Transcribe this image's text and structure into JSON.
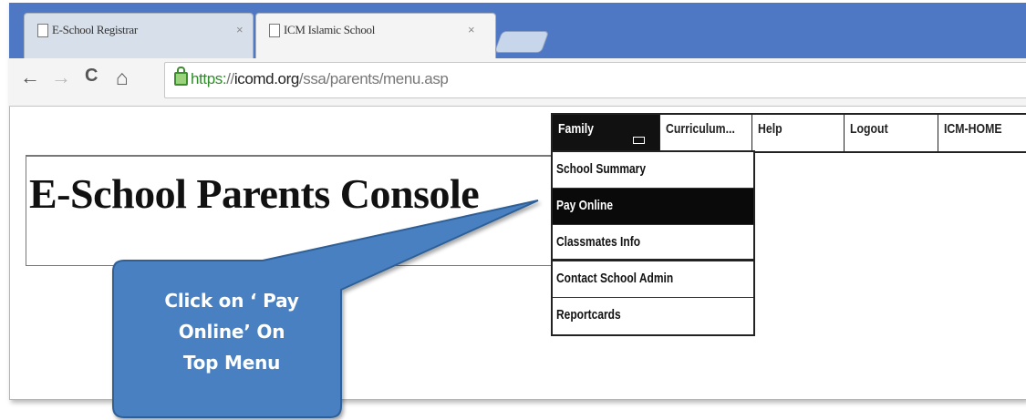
{
  "browser": {
    "tabs": [
      {
        "title": "E-School Registrar",
        "close": "×",
        "active": false
      },
      {
        "title": "ICM Islamic School",
        "close": "×",
        "active": true
      }
    ],
    "url": {
      "scheme": "https:",
      "sep": "//",
      "host": "icomd.org",
      "path": "/ssa/parents/menu.asp"
    }
  },
  "nav": {
    "back_icon": "←",
    "forward_icon": "→",
    "reload_icon": "C",
    "home_icon": "⌂"
  },
  "page": {
    "title": "E-School Parents Console",
    "menu": [
      {
        "label": "Family",
        "active": true
      },
      {
        "label": "Curriculum..."
      },
      {
        "label": "Help"
      },
      {
        "label": "Logout"
      },
      {
        "label": "ICM-HOME"
      }
    ],
    "dropdown": [
      {
        "label": "School Summary"
      },
      {
        "label": "Pay Online",
        "highlighted": true
      },
      {
        "label": "Classmates Info"
      },
      {
        "label": "Contact School Admin"
      },
      {
        "label": "Reportcards"
      }
    ]
  },
  "callout": {
    "lines": [
      "Click on ‘ Pay",
      "Online’ On",
      "Top Menu"
    ],
    "fill": "#4a80c1",
    "stroke": "#2f5f96"
  },
  "colors": {
    "tabstrip": "#4f78c4",
    "secure_green": "#2f8a2a"
  }
}
